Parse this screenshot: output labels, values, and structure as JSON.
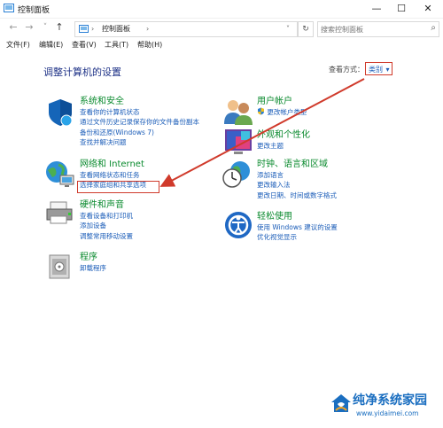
{
  "window": {
    "title": "控制面板",
    "minimize": "—",
    "maximize": "☐",
    "close": "✕"
  },
  "toolbar": {
    "back": "←",
    "forward": "→",
    "dropdown": "˅",
    "up": "↑",
    "breadcrumb": [
      "控制面板"
    ],
    "breadcrumb_sep": "›",
    "addr_dropdown": "˅",
    "refresh": "↻",
    "search_placeholder": "搜索控制面板",
    "search_icon": "search-icon"
  },
  "menubar": [
    "文件(F)",
    "编辑(E)",
    "查看(V)",
    "工具(T)",
    "帮助(H)"
  ],
  "content": {
    "heading": "调整计算机的设置",
    "view_by_label": "查看方式：",
    "view_by_value": "类别",
    "view_by_caret": "▾"
  },
  "categories_left": [
    {
      "title": "系统和安全",
      "icon": "shield-icon",
      "links": [
        "查看你的计算机状态",
        "通过文件历史记录保存你的文件备份副本",
        "备份和还原(Windows 7)",
        "查找并解决问题"
      ]
    },
    {
      "title": "网络和 Internet",
      "icon": "network-globe-icon",
      "links": [
        "查看网络状态和任务",
        "选择家庭组和共享选项"
      ]
    },
    {
      "title": "硬件和声音",
      "icon": "printer-icon",
      "links": [
        "查看设备和打印机",
        "添加设备",
        "调整常用移动设置"
      ]
    },
    {
      "title": "程序",
      "icon": "programs-icon",
      "links": [
        "卸载程序"
      ]
    }
  ],
  "categories_right": [
    {
      "title": "用户帐户",
      "icon": "user-accounts-icon",
      "links": [
        "更改帐户类型"
      ],
      "link_icon": "uac-shield-icon"
    },
    {
      "title": "外观和个性化",
      "icon": "appearance-icon",
      "links": [
        "更改主题"
      ]
    },
    {
      "title": "时钟、语言和区域",
      "icon": "clock-globe-icon",
      "links": [
        "添加语言",
        "更改输入法",
        "更改日期、时间或数字格式"
      ]
    },
    {
      "title": "轻松使用",
      "icon": "ease-of-access-icon",
      "links": [
        "使用 Windows 建议的设置",
        "优化视觉显示"
      ]
    }
  ],
  "annotation": {
    "color": "#d03a2b"
  },
  "watermark": {
    "title": "纯净系统家园",
    "url": "www.yidaimei.com",
    "color": "#1a6ec0"
  }
}
